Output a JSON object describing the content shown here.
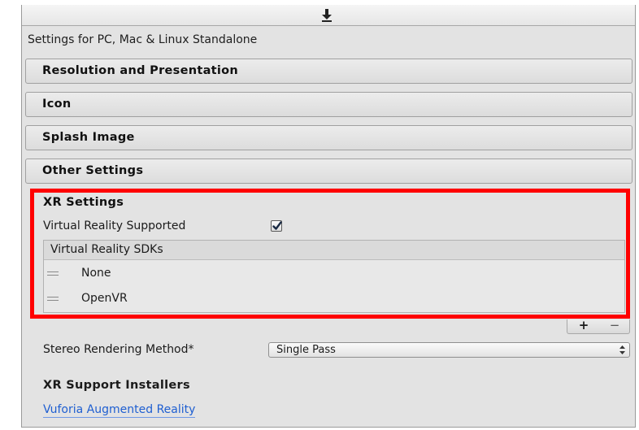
{
  "header": {
    "settings_for": "Settings for PC, Mac & Linux Standalone",
    "download_icon": "download-arrow-icon"
  },
  "sections": [
    {
      "label": "Resolution and Presentation"
    },
    {
      "label": "Icon"
    },
    {
      "label": "Splash Image"
    },
    {
      "label": "Other Settings"
    }
  ],
  "xr_settings": {
    "title": "XR Settings",
    "vr_supported_label": "Virtual Reality Supported",
    "vr_supported_checked": true,
    "sdk_list": {
      "header": "Virtual Reality SDKs",
      "items": [
        {
          "name": "None"
        },
        {
          "name": "OpenVR"
        }
      ],
      "add_label": "+",
      "remove_label": "−"
    },
    "highlight_color": "#ff0000"
  },
  "stereo": {
    "label": "Stereo Rendering Method*",
    "selected": "Single Pass"
  },
  "installers": {
    "title": "XR Support Installers",
    "link": "Vuforia Augmented Reality"
  },
  "colors": {
    "link": "#1f5fd1",
    "panel_bg": "#e3e3e3"
  }
}
